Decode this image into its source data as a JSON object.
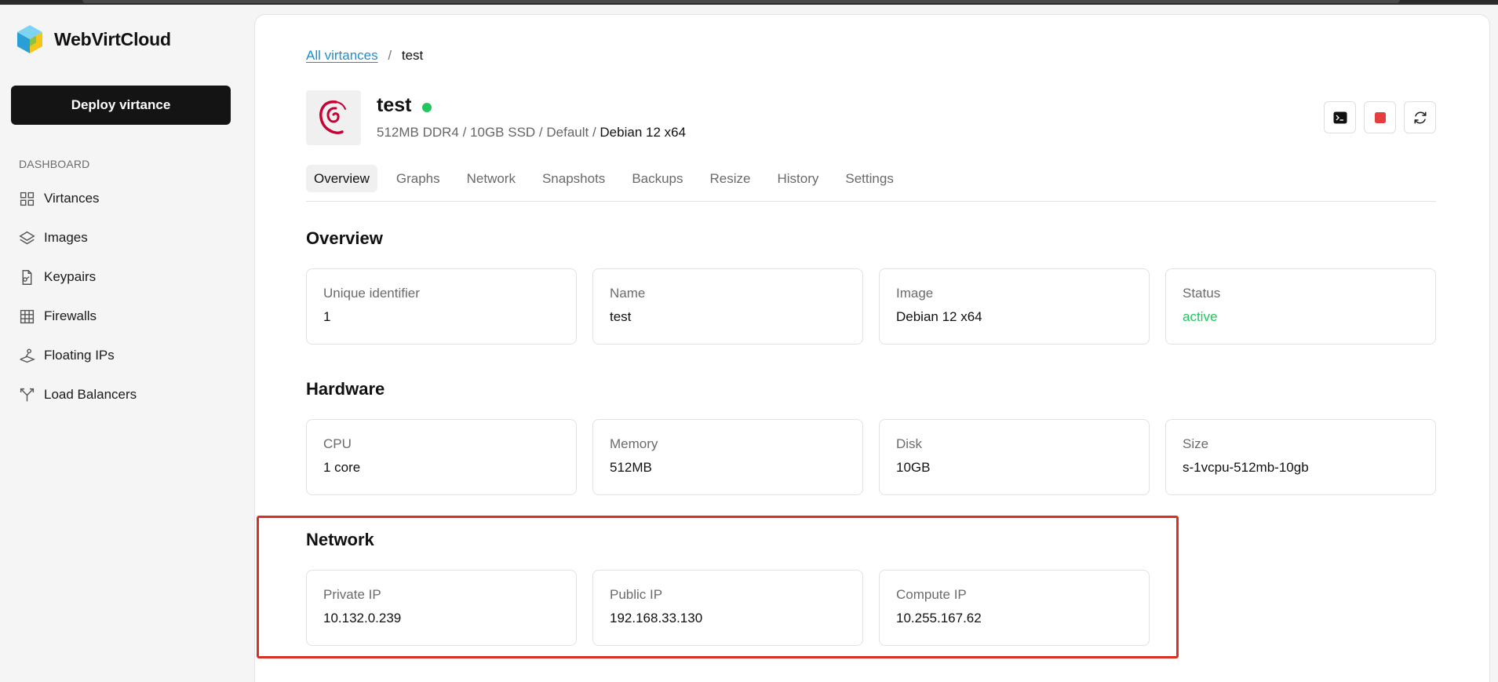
{
  "app": {
    "brand_name": "WebVirtCloud",
    "deploy_label": "Deploy virtance",
    "section_label": "DASHBOARD",
    "nav": [
      {
        "label": "Virtances",
        "icon": "grid-icon"
      },
      {
        "label": "Images",
        "icon": "layers-icon"
      },
      {
        "label": "Keypairs",
        "icon": "key-file-icon"
      },
      {
        "label": "Firewalls",
        "icon": "firewall-icon"
      },
      {
        "label": "Floating IPs",
        "icon": "floating-ip-icon"
      },
      {
        "label": "Load Balancers",
        "icon": "load-balancer-icon"
      }
    ]
  },
  "breadcrumb": {
    "root": "All virtances",
    "separator": "/",
    "current": "test"
  },
  "vm": {
    "name": "test",
    "status_color": "#22c55e",
    "specs": "512MB DDR4 / 10GB SSD / Default / ",
    "os": "Debian 12 x64",
    "actions": [
      {
        "name": "console-button",
        "icon": "terminal-icon"
      },
      {
        "name": "stop-button",
        "icon": "stop-icon"
      },
      {
        "name": "reboot-button",
        "icon": "refresh-icon"
      }
    ]
  },
  "tabs": [
    "Overview",
    "Graphs",
    "Network",
    "Snapshots",
    "Backups",
    "Resize",
    "History",
    "Settings"
  ],
  "active_tab": "Overview",
  "overview": {
    "title": "Overview",
    "cards": [
      {
        "label": "Unique identifier",
        "value": "1"
      },
      {
        "label": "Name",
        "value": "test"
      },
      {
        "label": "Image",
        "value": "Debian 12 x64"
      },
      {
        "label": "Status",
        "value": "active"
      }
    ]
  },
  "hardware": {
    "title": "Hardware",
    "cards": [
      {
        "label": "CPU",
        "value": "1 core"
      },
      {
        "label": "Memory",
        "value": "512MB"
      },
      {
        "label": "Disk",
        "value": "10GB"
      },
      {
        "label": "Size",
        "value": "s-1vcpu-512mb-10gb"
      }
    ]
  },
  "network": {
    "title": "Network",
    "cards": [
      {
        "label": "Private IP",
        "value": "10.132.0.239"
      },
      {
        "label": "Public IP",
        "value": "192.168.33.130"
      },
      {
        "label": "Compute IP",
        "value": "10.255.167.62"
      }
    ]
  },
  "colors": {
    "accent_link": "#1a8fd0",
    "status_active": "#22c55e",
    "stop_red": "#e53e3e",
    "highlight_border": "#d93025"
  }
}
